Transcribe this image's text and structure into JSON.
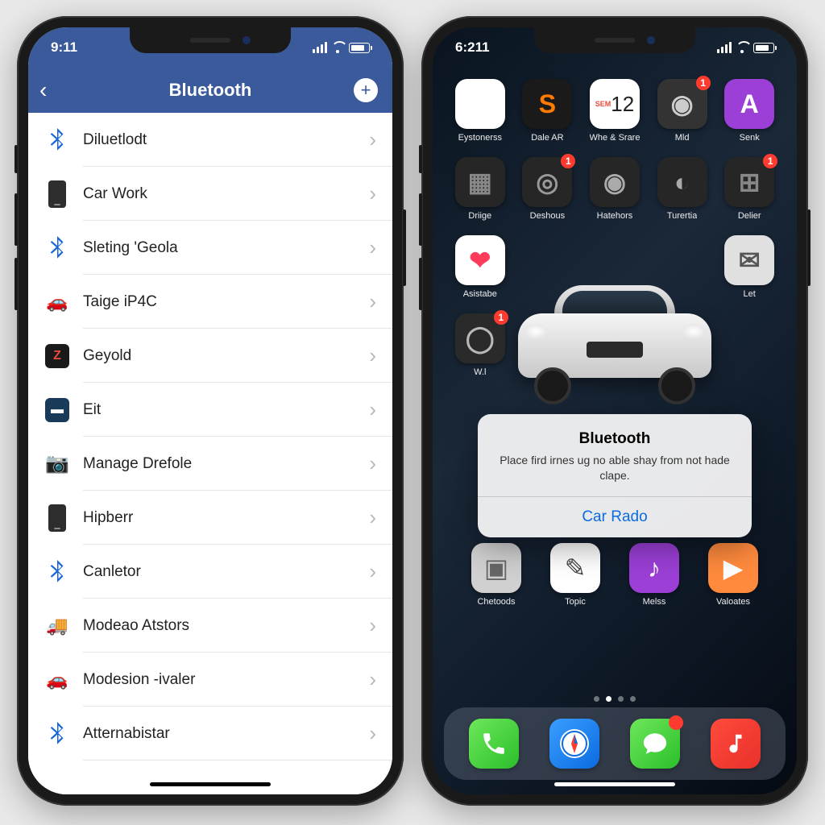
{
  "left": {
    "time": "9:11",
    "title": "Bluetooth",
    "rows": [
      {
        "icon": "bt",
        "label": "Diluetlodt"
      },
      {
        "icon": "phone",
        "label": "Car Work"
      },
      {
        "icon": "bt",
        "label": "Sleting 'Geola"
      },
      {
        "icon": "car",
        "label": "Taige iP4C"
      },
      {
        "icon": "sqblack",
        "label": "Geyold"
      },
      {
        "icon": "sqblue",
        "label": "Eit"
      },
      {
        "icon": "cam",
        "label": "Manage Drefole"
      },
      {
        "icon": "phone",
        "label": "Hipberr"
      },
      {
        "icon": "bt",
        "label": "Canletor"
      },
      {
        "icon": "truck",
        "label": "Modeao Atstors"
      },
      {
        "icon": "car",
        "label": "Modesion -ivaler"
      },
      {
        "icon": "bt",
        "label": "Atternabistar"
      }
    ]
  },
  "right": {
    "time": "6:211",
    "apps_row1": [
      {
        "bg": "#fff",
        "sym": "✿",
        "clr": "",
        "lbl": "Eystonerss"
      },
      {
        "bg": "#1a1a1a",
        "sym": "S",
        "clr": "#ff7a00",
        "lbl": "Dale AR"
      },
      {
        "bg": "#fff",
        "sym": "12",
        "clr": "#e74c3c",
        "lbl": "Whe & Srare",
        "sub": "cal"
      },
      {
        "bg": "#333",
        "sym": "◉",
        "clr": "#ccc",
        "lbl": "Mld",
        "badge": "1"
      },
      {
        "bg": "#9b3fd6",
        "sym": "A",
        "clr": "#fff",
        "lbl": "Senk"
      }
    ],
    "apps_row2": [
      {
        "bg": "#262626",
        "sym": "▦",
        "clr": "#888",
        "lbl": "Driige"
      },
      {
        "bg": "#262626",
        "sym": "◎",
        "clr": "#999",
        "lbl": "Deshous",
        "badge": "1"
      },
      {
        "bg": "#262626",
        "sym": "◉",
        "clr": "#aaa",
        "lbl": "Hatehors"
      },
      {
        "bg": "#262626",
        "sym": "◐",
        "clr": "#aaa",
        "lbl": "Turertia"
      },
      {
        "bg": "#262626",
        "sym": "⊞",
        "clr": "#888",
        "lbl": "Delier",
        "badge": "1"
      }
    ],
    "apps_row3": [
      {
        "bg": "#fff",
        "sym": "❤",
        "clr": "#ff3b5c",
        "lbl": "Asistabe"
      },
      {
        "bg": "",
        "sym": "",
        "clr": "",
        "lbl": ""
      },
      {
        "bg": "",
        "sym": "",
        "clr": "",
        "lbl": ""
      },
      {
        "bg": "",
        "sym": "",
        "clr": "",
        "lbl": ""
      },
      {
        "bg": "#e0e0e0",
        "sym": "✉",
        "clr": "#555",
        "lbl": "Let"
      }
    ],
    "apps_row4": [
      {
        "bg": "#2a2a2a",
        "sym": "◯",
        "clr": "#b8b8b8",
        "lbl": "W.l",
        "badge": "1"
      },
      {
        "bg": "",
        "sym": "",
        "clr": "",
        "lbl": ""
      },
      {
        "bg": "",
        "sym": "",
        "clr": "",
        "lbl": ""
      },
      {
        "bg": "",
        "sym": "",
        "clr": "",
        "lbl": ""
      },
      {
        "bg": "",
        "sym": "",
        "clr": "",
        "lbl": ""
      }
    ],
    "apps_bottom": [
      {
        "bg": "#d0d0d0",
        "sym": "▣",
        "clr": "#666",
        "lbl": "Chetoods"
      },
      {
        "bg": "#fff",
        "sym": "✎",
        "clr": "#444",
        "lbl": "Topic"
      },
      {
        "bg": "#9b3fd6",
        "sym": "♪",
        "clr": "#fff",
        "lbl": "Melss"
      },
      {
        "bg": "#ff8a3d",
        "sym": "▶",
        "clr": "#fff",
        "lbl": "Valoates"
      }
    ],
    "alert": {
      "title": "Bluetooth",
      "message": "Place fird irnes ug no able shay from not hade clape.",
      "button": "Car Rado"
    },
    "dock": [
      {
        "bg": "linear-gradient(135deg,#6ee85a,#2bbf2b)",
        "sym": "phone"
      },
      {
        "bg": "linear-gradient(135deg,#3a9eff,#0b6be0)",
        "sym": "compass"
      },
      {
        "bg": "linear-gradient(135deg,#6ee85a,#2bbf2b)",
        "sym": "msg",
        "badge": " "
      },
      {
        "bg": "linear-gradient(135deg,#ff4a3d,#e8312a)",
        "sym": "music"
      }
    ]
  }
}
